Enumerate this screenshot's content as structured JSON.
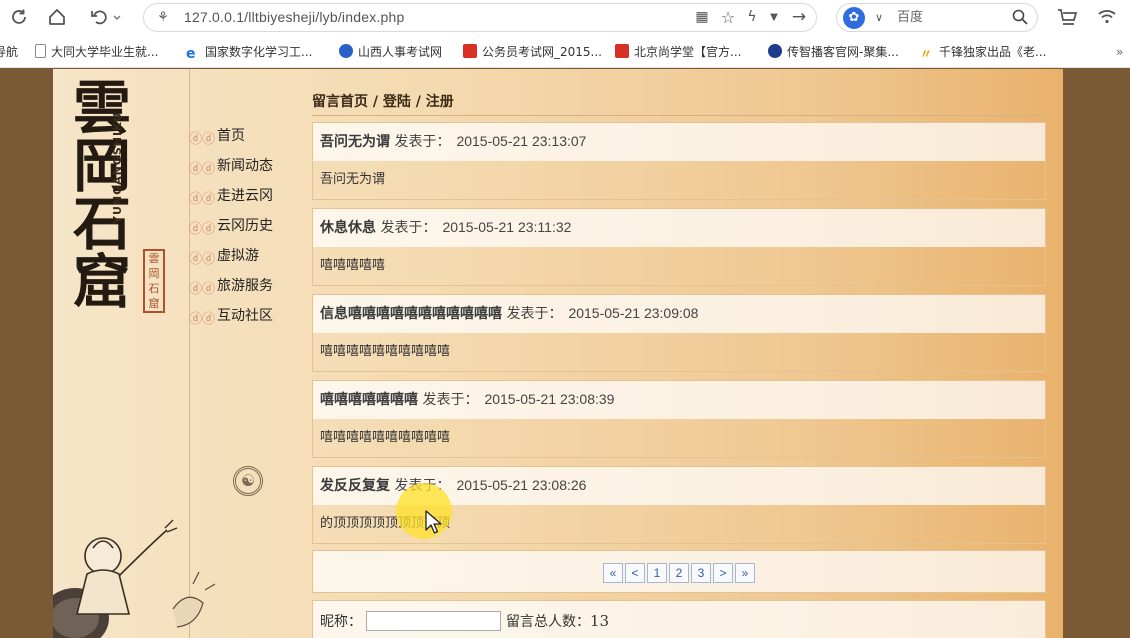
{
  "browser": {
    "url": "127.0.0.1/lltbiyesheji/lyb/index.php",
    "search_engine": "百度"
  },
  "bookmarks": [
    {
      "label": "导航",
      "color": "#ffffff"
    },
    {
      "label": "大同大学毕业生就...",
      "color": "#9aa0a6"
    },
    {
      "label": "国家数字化学习工...",
      "color": "#1a73e8"
    },
    {
      "label": "山西人事考试网",
      "color": "#2a61c9"
    },
    {
      "label": "公务员考试网_2015...",
      "color": "#d93025"
    },
    {
      "label": "北京尚学堂【官方...",
      "color": "#d93025"
    },
    {
      "label": "传智播客官网-聚集...",
      "color": "#1f3b8c"
    },
    {
      "label": "千锋独家出品《老...",
      "color": "#f29900"
    }
  ],
  "logo": {
    "chars": "雲岡石窟",
    "pinyin": "YUNGANGSHIKU",
    "seal": "雲岡石窟"
  },
  "nav": [
    {
      "label": "首页"
    },
    {
      "label": "新闻动态"
    },
    {
      "label": "走进云冈"
    },
    {
      "label": "云冈历史"
    },
    {
      "label": "虚拟游"
    },
    {
      "label": "旅游服务"
    },
    {
      "label": "互动社区"
    }
  ],
  "breadcrumb": "留言首页  / 登陆 / 注册",
  "messages": [
    {
      "author": "吾问无为谓",
      "label": "发表于：",
      "time": "2015-05-21 23:13:07",
      "body": "吾问无为谓"
    },
    {
      "author": "休息休息",
      "label": "发表于：",
      "time": "2015-05-21 23:11:32",
      "body": "嘻嘻嘻嘻嘻"
    },
    {
      "author": "信息嘻嘻嘻嘻嘻嘻嘻嘻嘻嘻嘻",
      "label": "发表于：",
      "time": "2015-05-21 23:09:08",
      "body": "嘻嘻嘻嘻嘻嘻嘻嘻嘻嘻"
    },
    {
      "author": "嘻嘻嘻嘻嘻嘻嘻",
      "label": "发表于：",
      "time": "2015-05-21 23:08:39",
      "body": "嘻嘻嘻嘻嘻嘻嘻嘻嘻嘻"
    },
    {
      "author": "发反反复复",
      "label": "发表于：",
      "time": "2015-05-21 23:08:26",
      "body": "的顶顶顶顶顶顶顶顶顶"
    }
  ],
  "pager": {
    "first": "«",
    "prev": "<",
    "pages": [
      "1",
      "2",
      "3"
    ],
    "next": ">",
    "last": "»"
  },
  "form": {
    "nick_label": "昵称：",
    "total_label": "留言总人数：",
    "total_count": "13"
  }
}
